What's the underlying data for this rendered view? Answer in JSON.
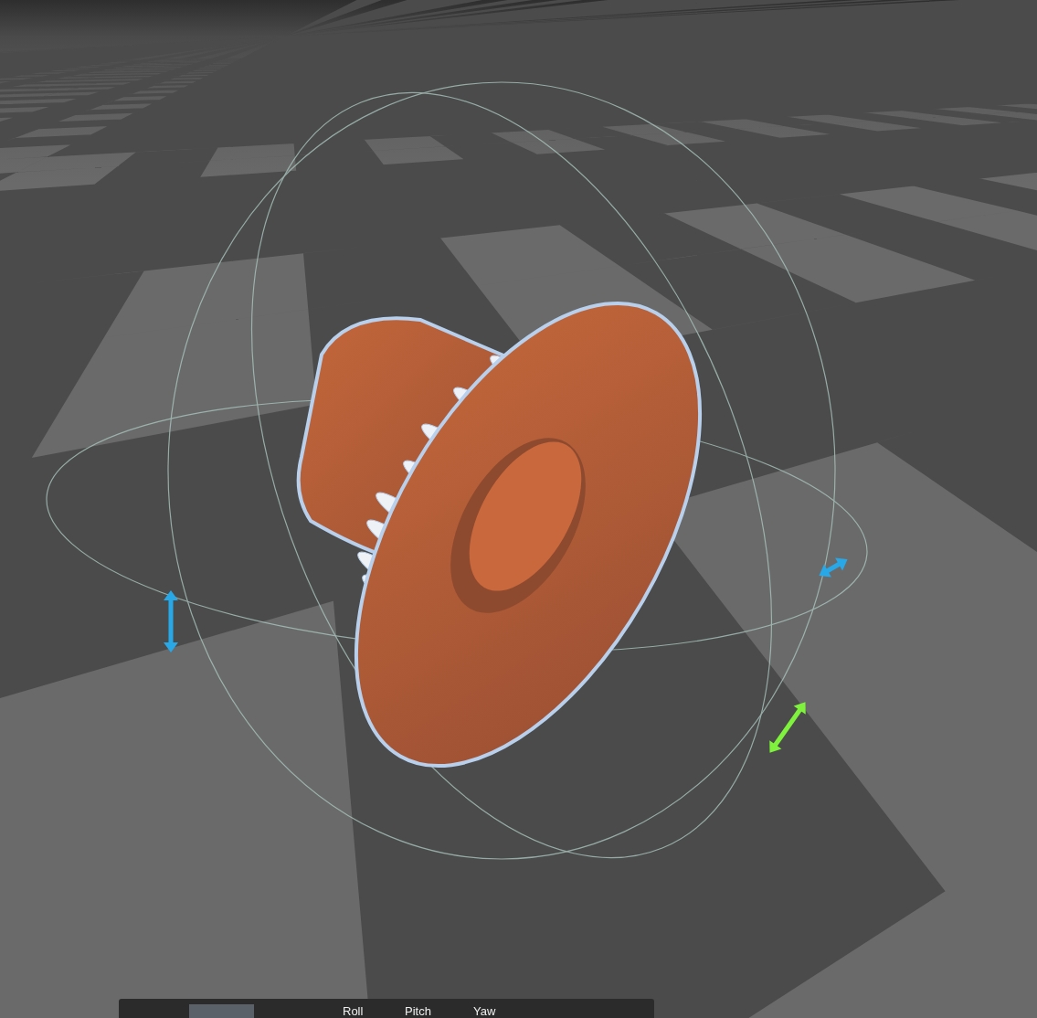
{
  "viewport": {
    "gizmo_handles": [
      {
        "kind": "vertical",
        "color": "#29a8e8"
      },
      {
        "kind": "diagonal-flat",
        "color": "#29a8e8"
      },
      {
        "kind": "diagonal",
        "color": "#7ef23c"
      }
    ]
  },
  "rotation_panel": {
    "swatch": {
      "color": "#5b6169"
    },
    "labels": [
      "Roll",
      "Pitch",
      "Yaw"
    ]
  }
}
